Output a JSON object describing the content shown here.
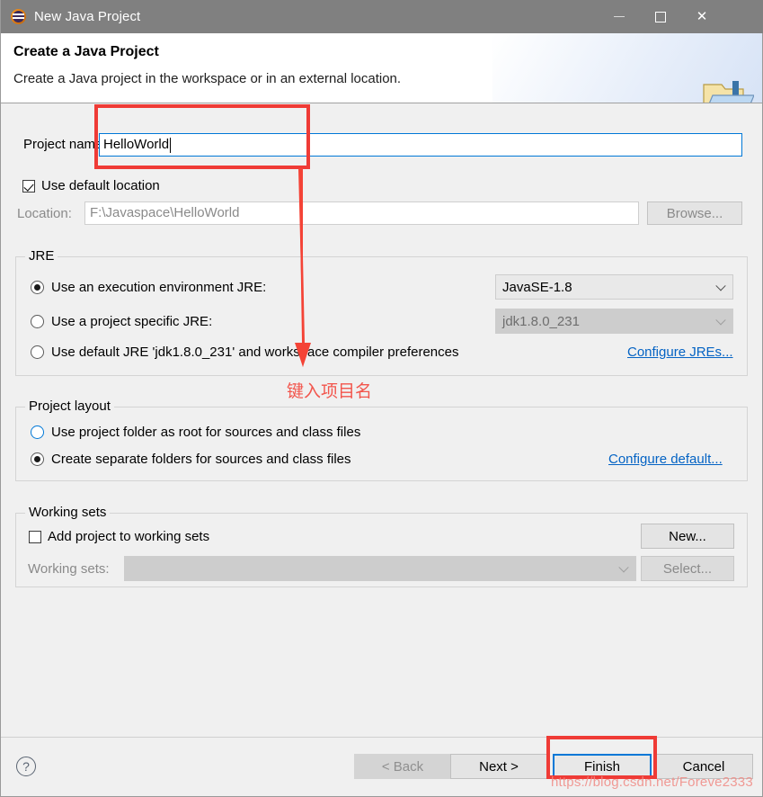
{
  "window": {
    "title": "New Java Project",
    "icon": "eclipse-icon",
    "controls": {
      "minimize": "–",
      "maximize": "□",
      "close": "✕"
    }
  },
  "header": {
    "title": "Create a Java Project",
    "subtitle": "Create a Java project in the workspace or in an external location.",
    "icon": "java-project-folder-icon"
  },
  "form": {
    "project_name_label": "Project name:",
    "project_name_value": "HelloWorld",
    "project_name_placeholder": "",
    "use_default_location_label": "Use default location",
    "use_default_location_checked": true,
    "location_label": "Location:",
    "location_value": "F:\\Javaspace\\HelloWorld",
    "browse_label": "Browse..."
  },
  "jre": {
    "group_title": "JRE",
    "options": [
      {
        "label": "Use an execution environment JRE:",
        "selected": true
      },
      {
        "label": "Use a project specific JRE:",
        "selected": false
      },
      {
        "label": "Use default JRE 'jdk1.8.0_231' and workspace compiler preferences",
        "selected": false
      }
    ],
    "execution_environment_value": "JavaSE-1.8",
    "project_specific_value": "jdk1.8.0_231",
    "configure_link": "Configure JREs..."
  },
  "project_layout": {
    "group_title": "Project layout",
    "options": [
      {
        "label": "Use project folder as root for sources and class files",
        "selected": false
      },
      {
        "label": "Create separate folders for sources and class files",
        "selected": true
      }
    ],
    "configure_link": "Configure default..."
  },
  "working_sets": {
    "group_title": "Working sets",
    "add_label": "Add project to working sets",
    "add_checked": false,
    "new_label": "New...",
    "sets_label": "Working sets:",
    "sets_value": "",
    "select_label": "Select..."
  },
  "footer": {
    "help_icon": "help-icon",
    "back_label": "< Back",
    "next_label": "Next >",
    "finish_label": "Finish",
    "cancel_label": "Cancel"
  },
  "annotations": {
    "chinese_note": "键入项目名",
    "watermark": "https://blog.csdn.net/Foreve2333",
    "highlight_color": "#ef3b36",
    "arrow": "down-arrow-annotation"
  }
}
